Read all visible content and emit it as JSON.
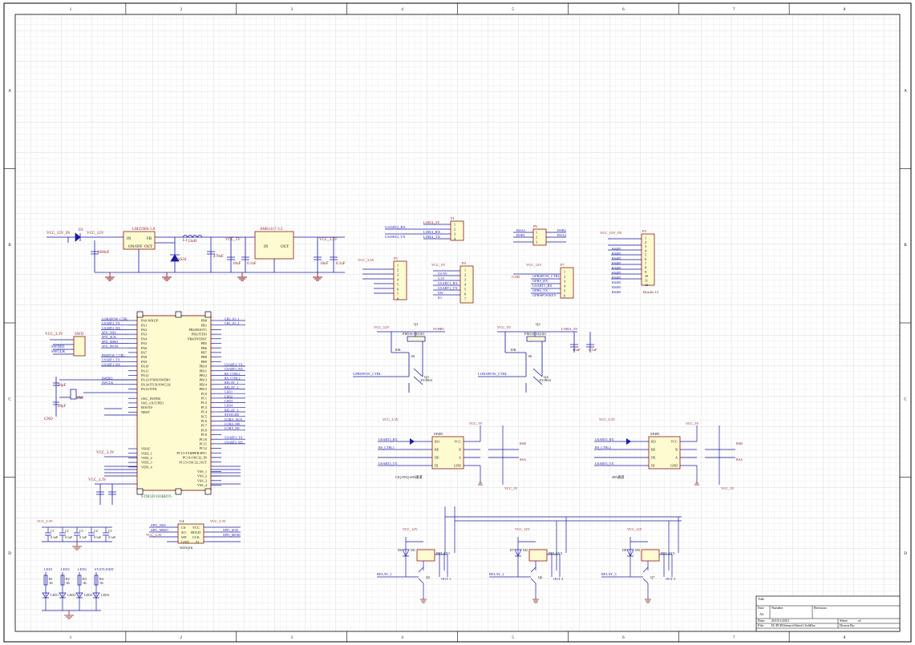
{
  "sheet": {
    "columns": [
      "1",
      "2",
      "3",
      "4",
      "5",
      "6",
      "7",
      "8"
    ],
    "rows": [
      "A",
      "B",
      "C",
      "D"
    ]
  },
  "title_block": {
    "title_label": "Title",
    "size_label": "Size",
    "size_value": "A2",
    "number_label": "Number",
    "revision_label": "Revision",
    "date_label": "Date:",
    "date_value": "2019/1/2021",
    "file_label": "File:",
    "file_value": "D:\\PCB\\Sensor\\Sheet1.SchDoc",
    "sheet_label": "Sheet",
    "sheet_of": "of",
    "drawn_label": "Drawn By:"
  },
  "power": {
    "vcc12_in": "VCC_12V_IN",
    "vcc12": "VCC_12V",
    "vcc5": "VCC_5V",
    "vcc33": "VCC_3.3V",
    "gnd": "GND",
    "lm2596": "LM2596S-5.0",
    "ams1117": "AMS1117-3.3",
    "l1": "L1",
    "l1_val": "33uH",
    "d1": "D1",
    "d5": "D5",
    "ss34": "SS34",
    "u2": "U2",
    "u3": "U3",
    "cap_1000": "1000uF",
    "cap_470": "470uF",
    "cap_10": "10uF",
    "cap_01": "0.1uF",
    "in_label": "IN",
    "out_label": "OUT",
    "fb_label": "FB",
    "onoff": "ON/OFF",
    "gnd_label": "GND"
  },
  "mcu": {
    "name": "STM32F103RBT6",
    "left_pins": [
      "PA0-WKUP",
      "PA1",
      "PA2",
      "PA3",
      "PA4",
      "PA5",
      "PA6",
      "PA7",
      "PA8",
      "PA9",
      "PA10",
      "PA11",
      "PA12",
      "PA13/JTMS/SWDIO",
      "PA14/JTCK/SWCLK",
      "PA15/JTDI",
      "OSC_IN/PD0",
      "OSC_OUT/PD1",
      "BOOT0",
      "NRST",
      "VBAT",
      "VDD_1",
      "VDD_2",
      "VDD_3",
      "VDD_4"
    ],
    "right_pins": [
      "PB0",
      "PB1",
      "PB2/BOOT1",
      "PB3/JTDO",
      "PB4/JNTRST",
      "PB5",
      "PB6",
      "PB7",
      "PB8",
      "PB9",
      "PB10",
      "PB11",
      "PB12",
      "PB13",
      "PB14",
      "PB15",
      "PC0",
      "PC1",
      "PC2",
      "PC3",
      "PC4",
      "PC5",
      "PC6",
      "PC7",
      "PC8",
      "PC9",
      "PC10",
      "PC11",
      "PC12",
      "PC13-TAMPER-RTC",
      "PC14-OSC32_IN",
      "PC15-OSC32_OUT",
      "VSS_1",
      "VSS_2",
      "VSS_3",
      "VSS_4"
    ],
    "left_nets": [
      "LORAPOW_CTRL",
      "USART2_TX",
      "USART2_RX",
      "SPI1_NSS",
      "SPI1_SCK",
      "SPI1_MISO",
      "SPI1_MOSI",
      "",
      "PRSPOW_CTRL",
      "USART1_TX",
      "USART1_RX",
      "",
      "",
      "SWDIO",
      "SWCLK"
    ],
    "right_nets": [
      "CRL_IO_1",
      "CRL_IO_2",
      "",
      "",
      "",
      "",
      "",
      "",
      "",
      "",
      "USART3_TX",
      "USART3_RX",
      "RS_CTRL1",
      "RS_CTRL2",
      "RELAY_1",
      "RELAY_2",
      "LED1",
      "LED2",
      "LED3",
      "LED4",
      "RELAY_3",
      "SYSTLED",
      "LORA_AUX",
      "LORA_M0",
      "LORA_M1",
      "",
      "USART3_TX",
      "USART3_RX",
      "",
      "",
      "",
      ""
    ],
    "crystal": "8M",
    "y1": "Y1",
    "c_22p": "20pF",
    "sw_label": "SWD",
    "sw_pins": [
      "SWDIO",
      "SWCLK"
    ]
  },
  "connectors": {
    "p1": "P1",
    "p2": "P2",
    "p3": "P3",
    "p4": "P4",
    "p5": "P5",
    "p6": "P6",
    "p7": "P7",
    "lora_3v": "LORA_3V",
    "usart2_rx": "USART2_RX",
    "usart2_tx": "USART2_TX",
    "lora_rx": "LORA_RX",
    "lora_tx": "LORA_TX",
    "rsa1": "RSA1",
    "rsb1": "RSB1",
    "rsa2": "RSA2",
    "rsb2": "RSB2",
    "p4_lines": [
      "5V/5V",
      "3.3V",
      "USART1_RX",
      "USART1_TX",
      "SW",
      "IO"
    ],
    "p7_lines": [
      "GPRSPOW_CTRL",
      "GPRS_RX",
      "USART1_RX",
      "GPRS_TX",
      "GPRSPOWKEY"
    ],
    "p3_lines": [
      "RS485",
      "RS485",
      "RS485",
      "RS485",
      "RS485",
      "RS485",
      "RS485",
      "RS485",
      "RS485",
      "RS485"
    ],
    "header12": "Header 12"
  },
  "switching": {
    "q1": "Q1",
    "q2": "Q2",
    "q3": "Q3",
    "q4": "Q4",
    "pmos": "PMOS-SI2301",
    "npn": "2N3904",
    "r_10k": "10K",
    "r_1k": "1K",
    "gprspow": "GPRSPOW_CTRL",
    "lorapow": "LORAPOW_CTRL",
    "v5v_label": "5VH85",
    "lora_3v": "LORA_3V"
  },
  "rs485": {
    "chip": "SP485",
    "pins_left": [
      "RO",
      "RE",
      "DE",
      "DI"
    ],
    "pins_right": [
      "VCC",
      "B",
      "A",
      "GND"
    ],
    "label1": "CIQ-DIQ-485通道",
    "label2": "485通道",
    "usart_rx": "USART3_RX",
    "usart_tx": "USART3_TX",
    "rs_ctrl": "RS_CTRL",
    "rsa": "RSA",
    "rsb": "RSB"
  },
  "relays": {
    "names": [
      "RELAY1",
      "RELAY2",
      "RELAY3"
    ],
    "ctrl": [
      "RELAY_1",
      "RELAY_2",
      "RELAY_3"
    ],
    "q": [
      "Q5",
      "Q6",
      "Q7"
    ],
    "d": [
      "D6",
      "D7",
      "D8"
    ],
    "m": [
      "M1",
      "M2",
      "M3"
    ],
    "k_label": [
      "OUT 1",
      "OUT 2",
      "OUT 3"
    ]
  },
  "leds": {
    "nets": [
      "LED1",
      "LED2",
      "LED3",
      "SYSTLIGHT"
    ],
    "r": [
      "R1",
      "R2",
      "R3",
      "R4"
    ],
    "d": [
      "LED1",
      "LED2",
      "LED3",
      "LED4"
    ],
    "val": "1K"
  },
  "flash": {
    "chip": "W25Q16",
    "u": "U4",
    "left": [
      "CS",
      "SO",
      "WP",
      "GND"
    ],
    "right": [
      "VCC",
      "HOLD",
      "CLK",
      "SI"
    ],
    "nets_left": [
      "SPI1_NSS",
      "SPI1_MISO",
      "VCC_3.3V"
    ],
    "nets_right": [
      "SPI1_SCK",
      "SPI1_MOSI"
    ]
  },
  "decoupling": {
    "caps": [
      "C1",
      "C2",
      "C3",
      "C4",
      "C5"
    ],
    "val": "0.1uF"
  }
}
